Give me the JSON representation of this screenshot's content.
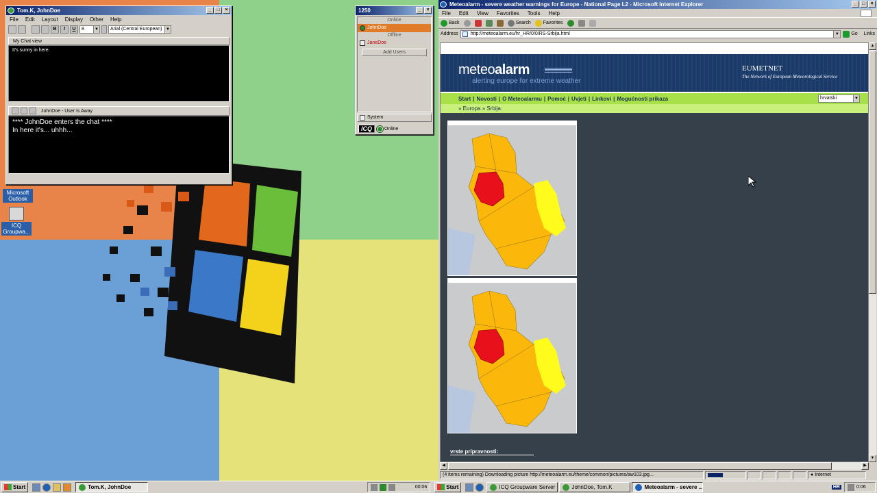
{
  "desktop": {
    "icons": [
      {
        "label": "Microsoft Outlook"
      },
      {
        "label": "ICQ Groupwa..."
      }
    ]
  },
  "chat_window": {
    "title": "Tom.K, JohnDoe",
    "menu": [
      "File",
      "Edit",
      "Layout",
      "Display",
      "Other",
      "Help"
    ],
    "font_size": "8",
    "font_name": "Arial (Central European)",
    "view_label": "My Chat view",
    "my_message": "It's sunny in here.",
    "other_user_status": "JohnDoe - User Is Away",
    "log_line_1": "**** JohnDoe enters the chat ****",
    "log_line_2": "In here it's... uhhh..."
  },
  "icq_window": {
    "title": "1250",
    "group_online": "Online",
    "contact_online": "JohnDoe",
    "group_offline": "Offline",
    "contact_offline": "JaneDoe",
    "add_users": "Add Users",
    "system": "System",
    "logo": "ICQ",
    "status": "Online"
  },
  "ie": {
    "title": "Meteoalarm - severe weather warnings for Europe - National Page L2 - Microsoft Internet Explorer",
    "menu": [
      "File",
      "Edit",
      "View",
      "Favorites",
      "Tools",
      "Help"
    ],
    "toolbar": {
      "back": "Back",
      "search": "Search",
      "favorites": "Favorites"
    },
    "address_label": "Address",
    "url": "http://meteoalarm.eu/hr_HR/0/0/RS-Srbija.html",
    "go": "Go",
    "links": "Links",
    "status_text": "(4 items remaining) Downloading picture http://meteoalarm.eu/theme/common/pictures/aw103.jpg...",
    "zone": "Internet"
  },
  "site": {
    "logo_light": "meteo",
    "logo_bold": "alarm",
    "slogan": "alerting europe for extreme weather",
    "partner": "EUMETNET",
    "partner_sub": "The Network of European Meteorological Service",
    "nav": [
      "Start",
      "Novosti",
      "O Meteoalarmu",
      "Pomoć",
      "Uvjeti",
      "Linkovi",
      "Mogućnosti prikaza"
    ],
    "language": "hrvatski",
    "crumb_1": "Europa",
    "crumb_2": "Srbija:",
    "section": "vrste pripravnosti:",
    "map_colors": {
      "red": "#e8101a",
      "orange": "#fbb80b",
      "yellow": "#fffc1c",
      "land": "#c9cbcc",
      "water": "#b7c7e0"
    }
  },
  "taskbar": {
    "start": "Start",
    "tasks_left": [
      "Tom.K, JohnDoe"
    ],
    "tray_left_time": "00:06",
    "tasks_right": [
      "Start",
      "ICQ Groupware Server",
      "JohnDoe, Tom.K",
      "Meteoalarm - severe ..."
    ],
    "lang": "HR",
    "clock": "0:06"
  }
}
